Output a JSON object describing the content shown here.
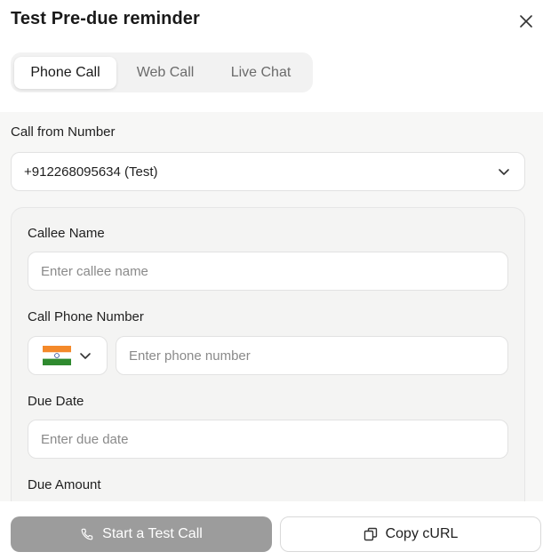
{
  "dialog": {
    "title": "Test Pre-due reminder",
    "close_icon": "close-icon"
  },
  "tabs": [
    {
      "label": "Phone Call",
      "active": true
    },
    {
      "label": "Web Call",
      "active": false
    },
    {
      "label": "Live Chat",
      "active": false
    }
  ],
  "call_from": {
    "label": "Call from Number",
    "value": "+912268095634 (Test)",
    "icon": "chevron-down-icon"
  },
  "form": {
    "callee_name": {
      "label": "Callee Name",
      "value": "",
      "placeholder": "Enter callee name"
    },
    "phone": {
      "label": "Call Phone Number",
      "country_flag": "india-flag-icon",
      "value": "",
      "placeholder": "Enter phone number"
    },
    "due_date": {
      "label": "Due Date",
      "value": "",
      "placeholder": "Enter due date"
    },
    "due_amount": {
      "label": "Due Amount"
    }
  },
  "footer": {
    "start_label": "Start a Test Call",
    "start_icon": "phone-icon",
    "copy_label": "Copy cURL",
    "copy_icon": "copy-icon"
  },
  "colors": {
    "primary_button_disabled": "#9c9c9c",
    "body_background": "#f7f7f6",
    "flag_saffron": "#f4892a",
    "flag_green": "#2f8a2f",
    "flag_chakra": "#1d3f8f"
  }
}
